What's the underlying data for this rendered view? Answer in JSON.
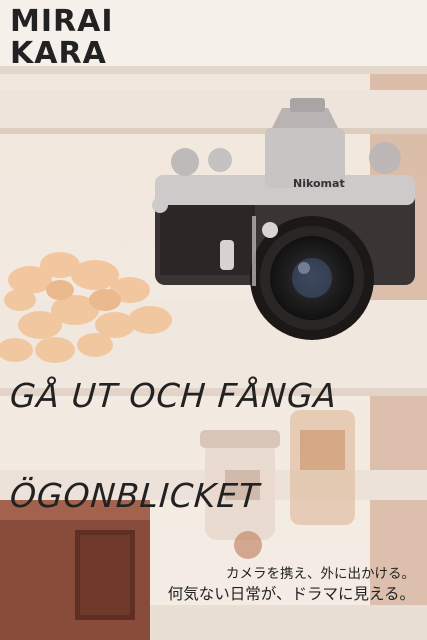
{
  "brand": {
    "line1": "MIRAI",
    "line2": "KARA"
  },
  "headline": {
    "line1": "GÅ UT OCH FÅNGA",
    "line2": "ÖGONBLICKET"
  },
  "caption": {
    "line1": "カメラを携え、外に出かける。",
    "line2": "何気ない日常が、ドラマに見える。"
  },
  "camera": {
    "brand_label": "Nikomat"
  },
  "colors": {
    "text": "#222222",
    "background": "#f3ece4",
    "flowers": "#f2c49a",
    "wood": "#b07a5a"
  }
}
